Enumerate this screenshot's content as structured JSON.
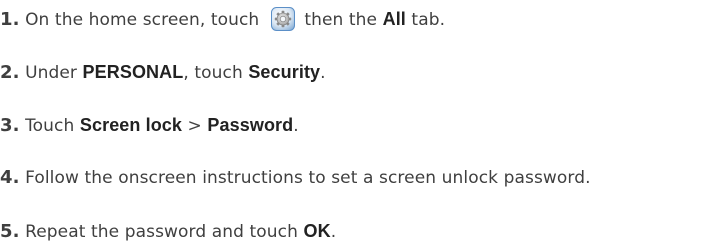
{
  "steps": [
    {
      "num": "1.",
      "t1": " On the home screen, touch ",
      "t2": " then the ",
      "b1": "All",
      "t3": " tab.",
      "icon": "settings-icon"
    },
    {
      "num": "2.",
      "t1": " Under ",
      "b1": "PERSONAL",
      "t2": ", touch ",
      "b2": "Security",
      "t3": "."
    },
    {
      "num": "3.",
      "t1": " Touch ",
      "b1": "Screen lock",
      "sep": " > ",
      "b2": "Password",
      "t2": "."
    },
    {
      "num": "4.",
      "t1": " Follow the onscreen instructions to set a screen unlock password."
    },
    {
      "num": "5.",
      "t1": " Repeat the password and touch ",
      "b1": "OK",
      "t2": "."
    }
  ],
  "colors": {
    "text": "#3f3f3f",
    "bold": "#222222",
    "icon_ring": "#5b8fc7"
  }
}
